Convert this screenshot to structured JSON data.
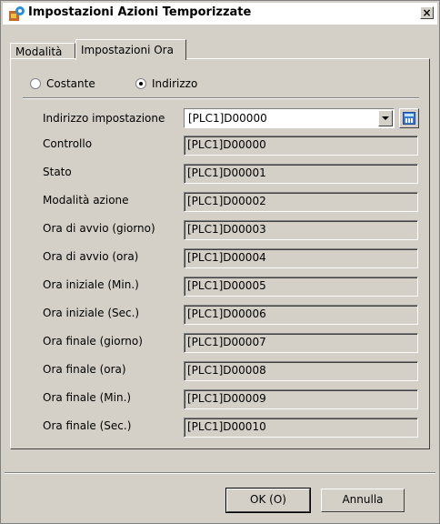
{
  "window": {
    "title": "Impostazioni Azioni Temporizzate",
    "close_label": "×"
  },
  "tabs": [
    {
      "label": "Modalità",
      "active": false
    },
    {
      "label": "Impostazioni Ora",
      "active": true
    }
  ],
  "mode": {
    "options": [
      {
        "label": "Costante",
        "selected": false
      },
      {
        "label": "Indirizzo",
        "selected": true
      }
    ]
  },
  "address_setting": {
    "label": "Indirizzo impostazione",
    "value": "[PLC1]D00000"
  },
  "fields": [
    {
      "label": "Controllo",
      "value": "[PLC1]D00000"
    },
    {
      "label": "Stato",
      "value": "[PLC1]D00001"
    },
    {
      "label": "Modalità azione",
      "value": "[PLC1]D00002"
    },
    {
      "label": "Ora di avvio (giorno)",
      "value": "[PLC1]D00003"
    },
    {
      "label": "Ora di avvio (ora)",
      "value": "[PLC1]D00004"
    },
    {
      "label": "Ora iniziale (Min.)",
      "value": "[PLC1]D00005"
    },
    {
      "label": "Ora iniziale (Sec.)",
      "value": "[PLC1]D00006"
    },
    {
      "label": "Ora finale (giorno)",
      "value": "[PLC1]D00007"
    },
    {
      "label": "Ora finale (ora)",
      "value": "[PLC1]D00008"
    },
    {
      "label": "Ora finale (Min.)",
      "value": "[PLC1]D00009"
    },
    {
      "label": "Ora finale (Sec.)",
      "value": "[PLC1]D00010"
    }
  ],
  "buttons": {
    "ok": "OK (O)",
    "cancel": "Annulla"
  },
  "icons": {
    "title": "settings-timer-icon",
    "keypad": "keypad-icon",
    "dropdown": "chevron-down-icon"
  }
}
